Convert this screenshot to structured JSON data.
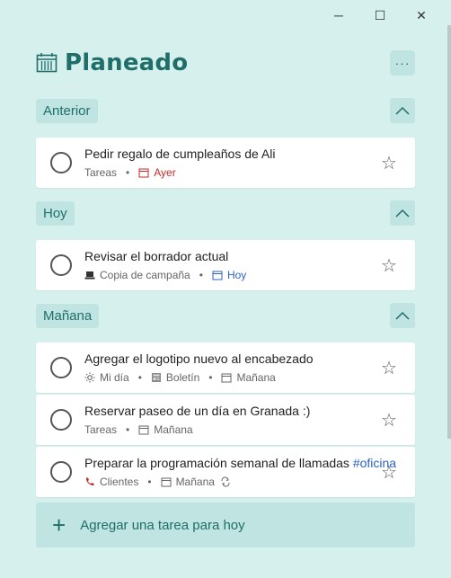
{
  "window": {
    "minimize": "─",
    "maximize": "☐",
    "close": "✕"
  },
  "header": {
    "title": "Planeado",
    "more": "···"
  },
  "groups": [
    {
      "label": "Anterior",
      "tasks": [
        {
          "title": "Pedir regalo de cumpleaños de Ali",
          "list": "Tareas",
          "due": "Ayer"
        }
      ]
    },
    {
      "label": "Hoy",
      "tasks": [
        {
          "title": "Revisar el borrador actual",
          "list": "Copia de campaña",
          "due": "Hoy"
        }
      ]
    },
    {
      "label": "Mañana",
      "tasks": [
        {
          "title": "Agregar el logotipo nuevo al encabezado",
          "my_day": "Mi día",
          "list": "Boletín",
          "due": "Mañana"
        },
        {
          "title": "Reservar paseo de un día en Granada :)",
          "list": "Tareas",
          "due": "Mañana"
        },
        {
          "title": "Preparar la programación semanal de llamadas",
          "tag": "#oficina",
          "list": "Clientes",
          "due": "Mañana"
        }
      ]
    }
  ],
  "add_task": {
    "label": "Agregar una tarea para hoy"
  },
  "colors": {
    "accent": "#1f6e6a",
    "background": "#d6f0ee",
    "overdue": "#c62a2a",
    "today": "#2e63c5"
  }
}
